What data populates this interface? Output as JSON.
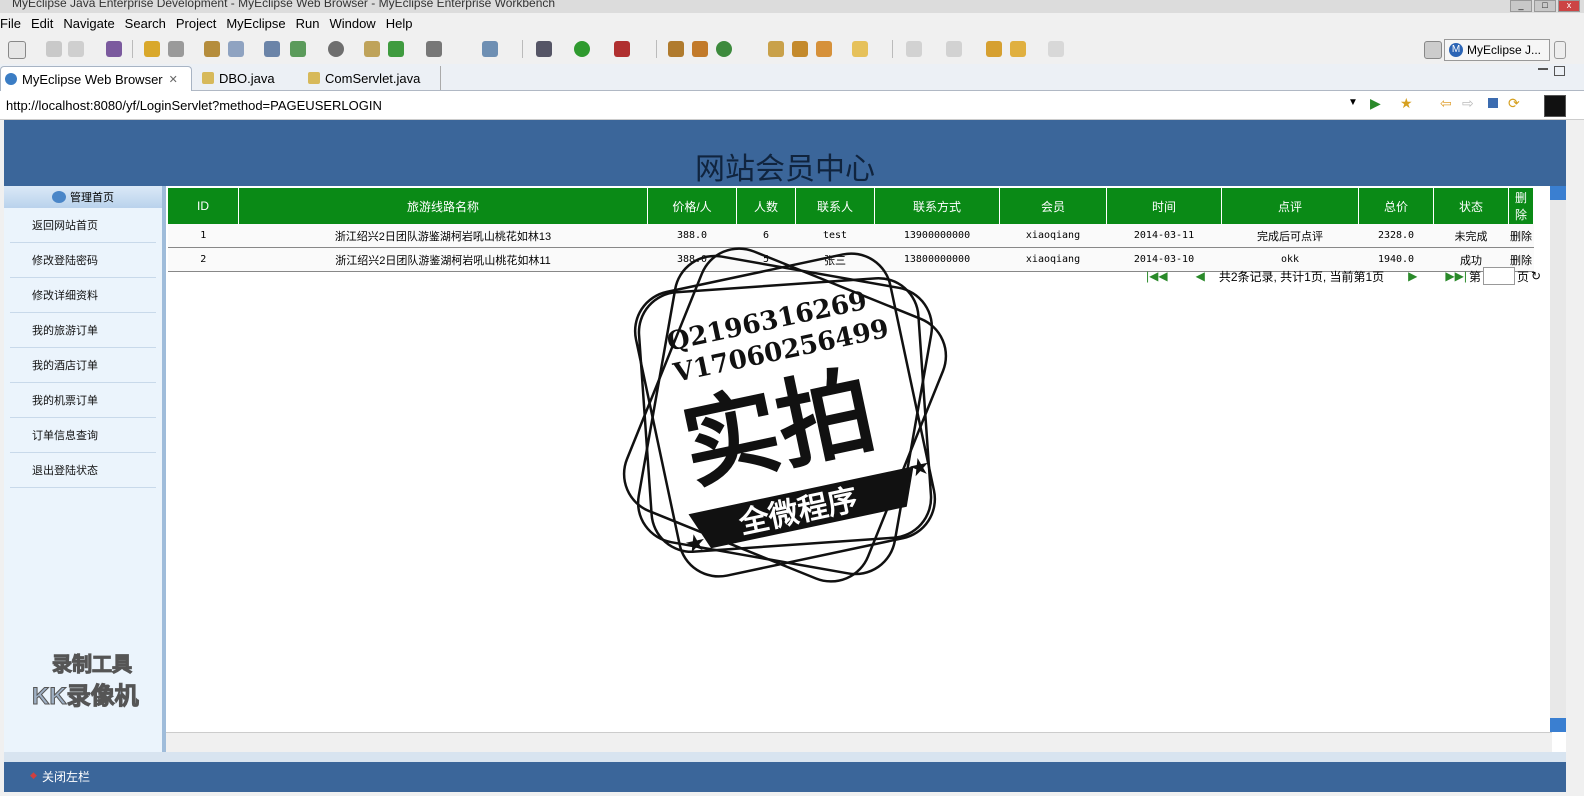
{
  "window": {
    "title": "MyEclipse Java Enterprise Development - MyEclipse Web Browser - MyEclipse Enterprise Workbench"
  },
  "menu": [
    "File",
    "Edit",
    "Navigate",
    "Search",
    "Project",
    "MyEclipse",
    "Run",
    "Window",
    "Help"
  ],
  "perspective": {
    "label": "MyEclipse J..."
  },
  "tabs": [
    {
      "label": "MyEclipse Web Browser",
      "close": "✕"
    },
    {
      "label": "DBO.java"
    },
    {
      "label": "ComServlet.java"
    }
  ],
  "browser": {
    "url": "http://localhost:8080/yf/LoginServlet?method=PAGEUSERLOGIN"
  },
  "page": {
    "title": "网站会员中心",
    "sidebar": {
      "head": "管理首页",
      "items": [
        "返回网站首页",
        "修改登陆密码",
        "修改详细资料",
        "我的旅游订单",
        "我的酒店订单",
        "我的机票订单",
        "订单信息查询",
        "退出登陆状态"
      ]
    },
    "table": {
      "headers": [
        "ID",
        "旅游线路名称",
        "价格/人",
        "人数",
        "联系人",
        "联系方式",
        "会员",
        "时间",
        "点评",
        "总价",
        "状态",
        "删除"
      ],
      "rows": [
        [
          "1",
          "浙江绍兴2日团队游鉴湖柯岩吼山桃花如林13",
          "388.0",
          "6",
          "test",
          "13900000000",
          "xiaoqiang",
          "2014-03-11",
          "完成后可点评",
          "2328.0",
          "未完成",
          "删除"
        ],
        [
          "2",
          "浙江绍兴2日团队游鉴湖柯岩吼山桃花如林11",
          "388.0",
          "5",
          "张三",
          "13800000000",
          "xiaoqiang",
          "2014-03-10",
          "okk",
          "1940.0",
          "成功",
          "删除"
        ]
      ]
    },
    "pager": {
      "summary": "共2条记录, 共计1页, 当前第1页",
      "di": "第",
      "ye": "页"
    },
    "footer": {
      "close_left": "关闭左栏"
    }
  },
  "watermark": {
    "qq": "Q2196316269",
    "wx": "V17060256499",
    "big": "实拍",
    "banner": "全微程序"
  },
  "recorder": {
    "line1": "录制工具",
    "line2": "KK录像机"
  },
  "colors": {
    "header": "#3b669a",
    "table_head": "#0a8a16",
    "sidebar": "#ebf4fc"
  }
}
